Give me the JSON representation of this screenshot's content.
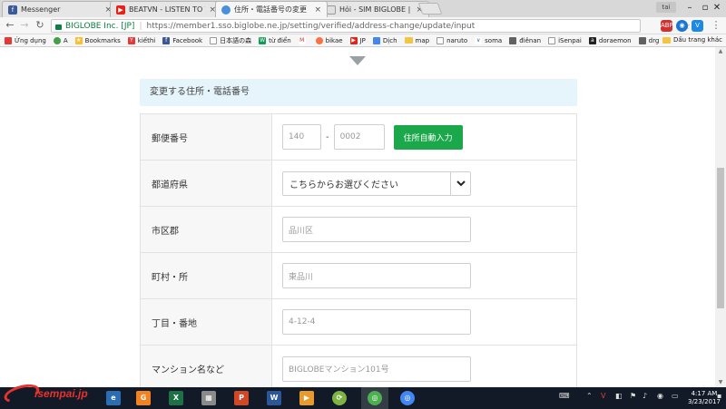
{
  "browser": {
    "tabs": [
      {
        "label": "Messenger",
        "icon": "facebook-icon",
        "color": "#3b5998"
      },
      {
        "label": "BEATVN - LISTEN TO TH",
        "icon": "youtube-icon",
        "color": "#e62117"
      },
      {
        "label": "住所・電話番号の変更",
        "icon": "globe-icon",
        "color": "#4a90d9"
      },
      {
        "label": "Hỏi - SIM BIGLOBE | Diễ",
        "icon": "page-icon",
        "color": "#9e9e9e"
      }
    ],
    "user_badge": "tai",
    "secure_label": "BIGLOBE Inc. [JP]",
    "url": "https://member1.sso.biglobe.ne.jp/setting/verified/address-change/update/input"
  },
  "bookmarks": {
    "items": [
      {
        "label": "Ứng dụng",
        "color": "#e53935"
      },
      {
        "label": "A",
        "color": "#43a047"
      },
      {
        "label": "Bookmarks",
        "color": "#fbc02d"
      },
      {
        "label": "kiếthi",
        "color": "#e53935"
      },
      {
        "label": "Facebook",
        "color": "#3b5998"
      },
      {
        "label": "日本語の森",
        "color": "#666666"
      },
      {
        "label": "từ điển",
        "color": "#0f9d58"
      },
      {
        "label": "",
        "color": "#d93025"
      },
      {
        "label": "bikae",
        "color": "#ff7043"
      },
      {
        "label": "JP",
        "color": "#e62117"
      },
      {
        "label": "Dịch",
        "color": "#4285f4"
      },
      {
        "label": "map",
        "color": "#fbc02d"
      },
      {
        "label": "naruto",
        "color": "#bdbdbd"
      },
      {
        "label": "soma",
        "color": "#1565c0"
      },
      {
        "label": "điênan",
        "color": "#616161"
      },
      {
        "label": "iSenpai",
        "color": "#7cb342"
      },
      {
        "label": "doraemon",
        "color": "#212121"
      },
      {
        "label": "drg",
        "color": "#616161"
      }
    ],
    "other": "Dấu trang khác"
  },
  "page": {
    "section_title": "変更する住所・電話番号",
    "fields": {
      "postal_label": "郵便番号",
      "postal_1": "140",
      "postal_2": "0002",
      "postal_dash": "-",
      "auto_button": "住所自動入力",
      "prefecture_label": "都道府県",
      "prefecture_value": "こちらからお選びください",
      "city_label": "市区郡",
      "city_placeholder": "品川区",
      "town_label": "町村・所",
      "town_placeholder": "東品川",
      "chome_label": "丁目・番地",
      "chome_placeholder": "4-12-4",
      "mansion_label": "マンション名など",
      "mansion_placeholder": "BIGLOBEマンション101号"
    }
  },
  "watermark": "isempai.jp",
  "taskbar": {
    "clock_time": "4:17 AM",
    "clock_date": "3/23/2017"
  }
}
